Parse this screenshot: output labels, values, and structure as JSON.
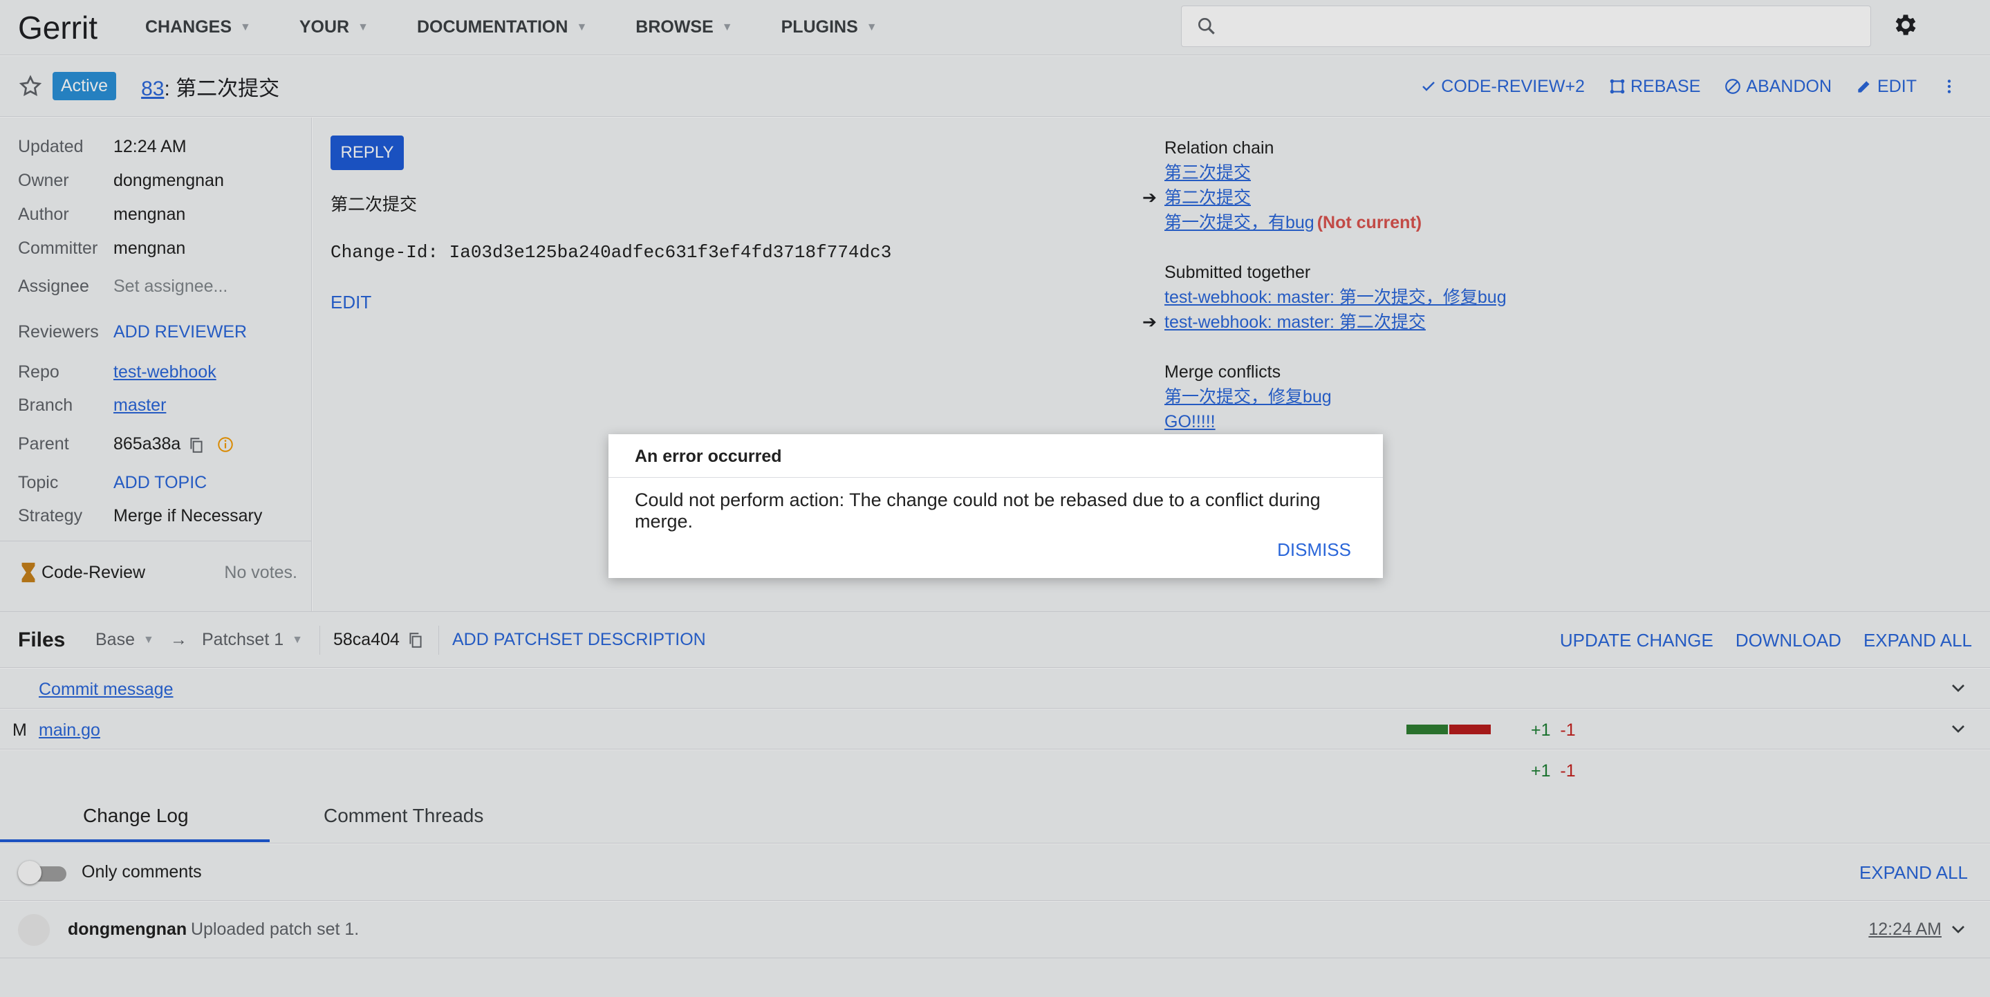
{
  "app": {
    "logo": "Gerrit",
    "nav": [
      "CHANGES",
      "YOUR",
      "DOCUMENTATION",
      "BROWSE",
      "PLUGINS"
    ]
  },
  "change": {
    "status": "Active",
    "number": "83",
    "title_sep": ":",
    "title": "第二次提交",
    "actions": {
      "code_review": "CODE-REVIEW+2",
      "rebase": "REBASE",
      "abandon": "ABANDON",
      "edit": "EDIT"
    }
  },
  "metadata": {
    "updated": {
      "label": "Updated",
      "value": "12:24 AM"
    },
    "owner": {
      "label": "Owner",
      "value": "dongmengnan"
    },
    "author": {
      "label": "Author",
      "value": "mengnan"
    },
    "committer": {
      "label": "Committer",
      "value": "mengnan"
    },
    "assignee": {
      "label": "Assignee",
      "value": "Set assignee..."
    },
    "reviewers": {
      "label": "Reviewers",
      "value": "ADD REVIEWER"
    },
    "repo": {
      "label": "Repo",
      "value": "test-webhook"
    },
    "branch": {
      "label": "Branch",
      "value": "master"
    },
    "parent": {
      "label": "Parent",
      "value": "865a38a"
    },
    "topic": {
      "label": "Topic",
      "value": "ADD TOPIC"
    },
    "strategy": {
      "label": "Strategy",
      "value": "Merge if Necessary"
    },
    "code_review": {
      "label": "Code-Review",
      "votes": "No votes."
    }
  },
  "commit": {
    "reply_label": "REPLY",
    "subject": "第二次提交",
    "change_id": "Change-Id: Ia03d3e125ba240adfec631f3ef4fd3718f774dc3",
    "edit_label": "EDIT"
  },
  "related": {
    "relation_chain": {
      "title": "Relation chain",
      "items": [
        "第三次提交",
        "第二次提交",
        "第一次提交，有bug"
      ],
      "not_current": "(Not current)"
    },
    "submitted_together": {
      "title": "Submitted together",
      "items": [
        "test-webhook: master: 第一次提交，修复bug",
        "test-webhook: master: 第二次提交"
      ]
    },
    "merge_conflicts": {
      "title": "Merge conflicts",
      "items": [
        "第一次提交，修复bug",
        "GO!!!!!"
      ]
    }
  },
  "files": {
    "title": "Files",
    "base": "Base",
    "arrow": "→",
    "patchset": "Patchset 1",
    "commit_hash": "58ca404",
    "add_desc": "ADD PATCHSET DESCRIPTION",
    "actions": [
      "UPDATE CHANGE",
      "DOWNLOAD",
      "EXPAND ALL"
    ],
    "commit_message_label": "Commit message",
    "rows": [
      {
        "status": "M",
        "name": "main.go",
        "added": "+1",
        "deleted": "-1"
      }
    ],
    "total": {
      "added": "+1",
      "deleted": "-1"
    },
    "colors": {
      "added_bar": "#2e7d32",
      "deleted_bar": "#b71c1c"
    }
  },
  "tabs": {
    "change_log": "Change Log",
    "comment_threads": "Comment Threads"
  },
  "log": {
    "only_comments": "Only comments",
    "expand_all": "EXPAND ALL",
    "messages": [
      {
        "author": "dongmengnan",
        "text": "Uploaded patch set 1.",
        "time": "12:24 AM"
      }
    ]
  },
  "dialog": {
    "title": "An error occurred",
    "message": "Could not perform action: The change could not be rebased due to a conflict during merge.",
    "dismiss": "DISMISS"
  }
}
